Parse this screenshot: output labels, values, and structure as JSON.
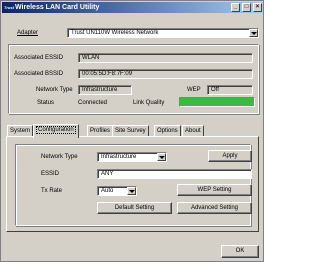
{
  "window": {
    "title": "Wireless LAN Card Utility",
    "logo": "Trust"
  },
  "adapter": {
    "label": "Adapter",
    "value": "Trust UN110W Wireless Network"
  },
  "status_panel": {
    "essid_label": "Associated ESSID",
    "essid_value": "WLAN",
    "bssid_label": "Associated BSSID",
    "bssid_value": "00:05:5D:F8:7F:09",
    "network_type_label": "Network Type",
    "network_type_value": "Infrastructure",
    "wep_label": "WEP",
    "wep_value": "Off",
    "status_label": "Status",
    "status_value": "Connected",
    "link_quality_label": "Link Quality",
    "link_quality_color": "#3fb83f"
  },
  "tabs": [
    {
      "label": "System"
    },
    {
      "label": "Configuration"
    },
    {
      "label": "Profiles"
    },
    {
      "label": "Site Survey"
    },
    {
      "label": "Options"
    },
    {
      "label": "About"
    }
  ],
  "config": {
    "network_type_label": "Network Type",
    "network_type_value": "Infrastructure",
    "apply_label": "Apply",
    "essid_label": "ESSID",
    "essid_value": "ANY",
    "tx_rate_label": "Tx Rate",
    "tx_rate_value": "Auto",
    "wep_setting_label": "WEP Setting",
    "default_setting_label": "Default Setting",
    "advanced_setting_label": "Advanced Setting"
  },
  "ok_label": "OK"
}
